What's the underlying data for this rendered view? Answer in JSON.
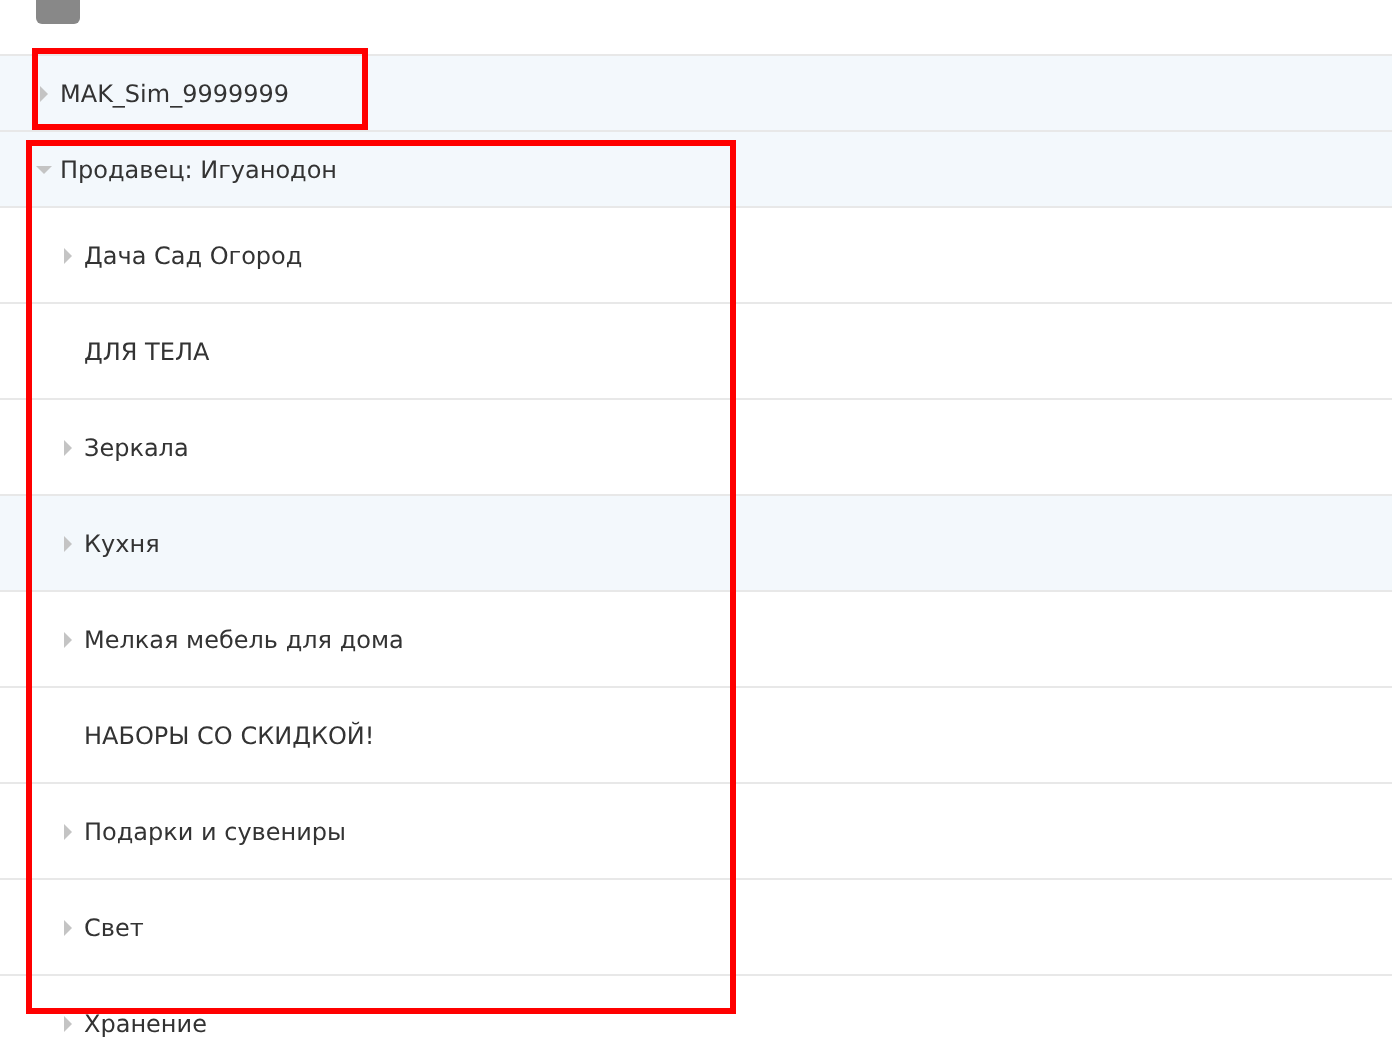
{
  "tree": [
    {
      "label": "MAK_Sim_9999999",
      "kind": "collapsed",
      "selected": true
    },
    {
      "label": "Продавец: Игуанодон",
      "kind": "expanded",
      "selected": true,
      "children": [
        {
          "label": "Дача Сад Огород",
          "kind": "collapsed",
          "selected": false
        },
        {
          "label": "ДЛЯ ТЕЛА",
          "kind": "leaf",
          "selected": false
        },
        {
          "label": "Зеркала",
          "kind": "collapsed",
          "selected": false
        },
        {
          "label": "Кухня",
          "kind": "collapsed",
          "selected": true
        },
        {
          "label": "Мелкая мебель для дома",
          "kind": "collapsed",
          "selected": false
        },
        {
          "label": "НАБОРЫ СО СКИДКОЙ!",
          "kind": "leaf",
          "selected": false
        },
        {
          "label": "Подарки и сувениры",
          "kind": "collapsed",
          "selected": false
        },
        {
          "label": "Свет",
          "kind": "collapsed",
          "selected": false
        },
        {
          "label": "Хранение",
          "kind": "collapsed",
          "selected": false
        }
      ]
    }
  ]
}
